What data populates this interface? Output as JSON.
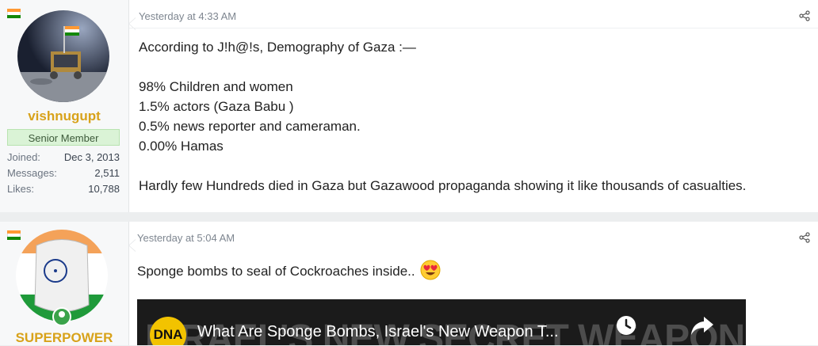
{
  "posts": [
    {
      "user": {
        "name": "vishnugupt",
        "title": "Senior Member",
        "joined_label": "Joined:",
        "joined": "Dec 3, 2013",
        "messages_label": "Messages:",
        "messages": "2,511",
        "likes_label": "Likes:",
        "likes": "10,788"
      },
      "time": "Yesterday at 4:33 AM",
      "lines": [
        "According to J!h@!s, Demography of Gaza :—",
        "",
        "98% Children and women",
        "1.5% actors (Gaza Babu )",
        "0.5% news reporter and cameraman.",
        "0.00% Hamas",
        "",
        "Hardly few Hundreds died in Gaza but Gazawood propaganda showing it like thousands of casualties."
      ]
    },
    {
      "user": {
        "name": "SUPERPOWER"
      },
      "time": "Yesterday at 5:04 AM",
      "text": "Sponge bombs to seal of Cockroaches inside..",
      "emoji": "heart-eyes",
      "video": {
        "channel_logo": "DNA",
        "title": "What Are Sponge Bombs, Israel's New Weapon T...",
        "thumbnail_text": "ISRAEL'S NEW SECRET WEAPON"
      }
    }
  ],
  "colors": {
    "username": "#d8a21a",
    "badge_bg": "#daf3d6"
  }
}
